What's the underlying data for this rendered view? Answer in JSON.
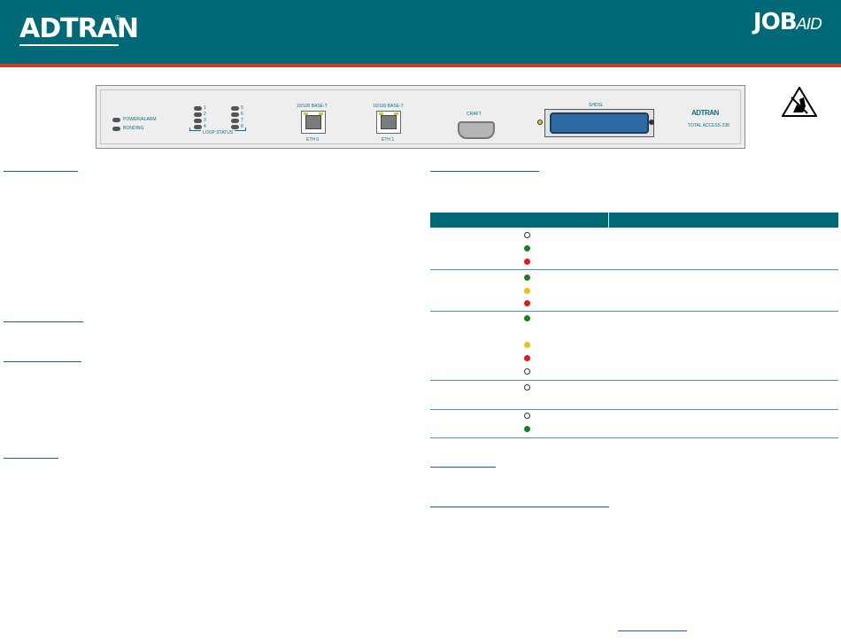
{
  "header": {
    "brand_logo": "ADTRAN",
    "brand_registered": "®",
    "job_prefix": "JOB",
    "job_suffix": "AID",
    "background_color": "#006978",
    "rule_color": "#d4391c"
  },
  "front_panel": {
    "power_alarm_label": "POWER/ALARM",
    "bonding_label": "BONDING",
    "loop_numbers": [
      "1",
      "2",
      "3",
      "4",
      "5",
      "6",
      "7",
      "8"
    ],
    "loop_status_label": "LOOP STATUS",
    "eth0_top_label": "10/100 BASE-T",
    "eth0_label": "ETH 0",
    "eth1_top_label": "10/100 BASE-T",
    "eth1_label": "ETH 1",
    "craft_label": "CRAFT",
    "shdsl_label": "SHDSL",
    "panel_brand": "ADTRAN",
    "model_label": "TOTAL ACCESS 238"
  },
  "esd_icon": "esd-warning-icon",
  "led_table": {
    "header_color": "#006978",
    "groups": [
      {
        "dots": [
          "off",
          "green",
          "red"
        ]
      },
      {
        "dots": [
          "green",
          "yellow",
          "red"
        ]
      },
      {
        "dots": [
          "green",
          "yellow",
          "red",
          "off"
        ]
      },
      {
        "dots": [
          "off"
        ]
      },
      {
        "dots": [
          "off",
          "green"
        ]
      }
    ],
    "colors": {
      "green": "#1e7d1e",
      "yellow": "#e8c410",
      "red": "#e01b1b",
      "off": "#ffffff"
    }
  }
}
